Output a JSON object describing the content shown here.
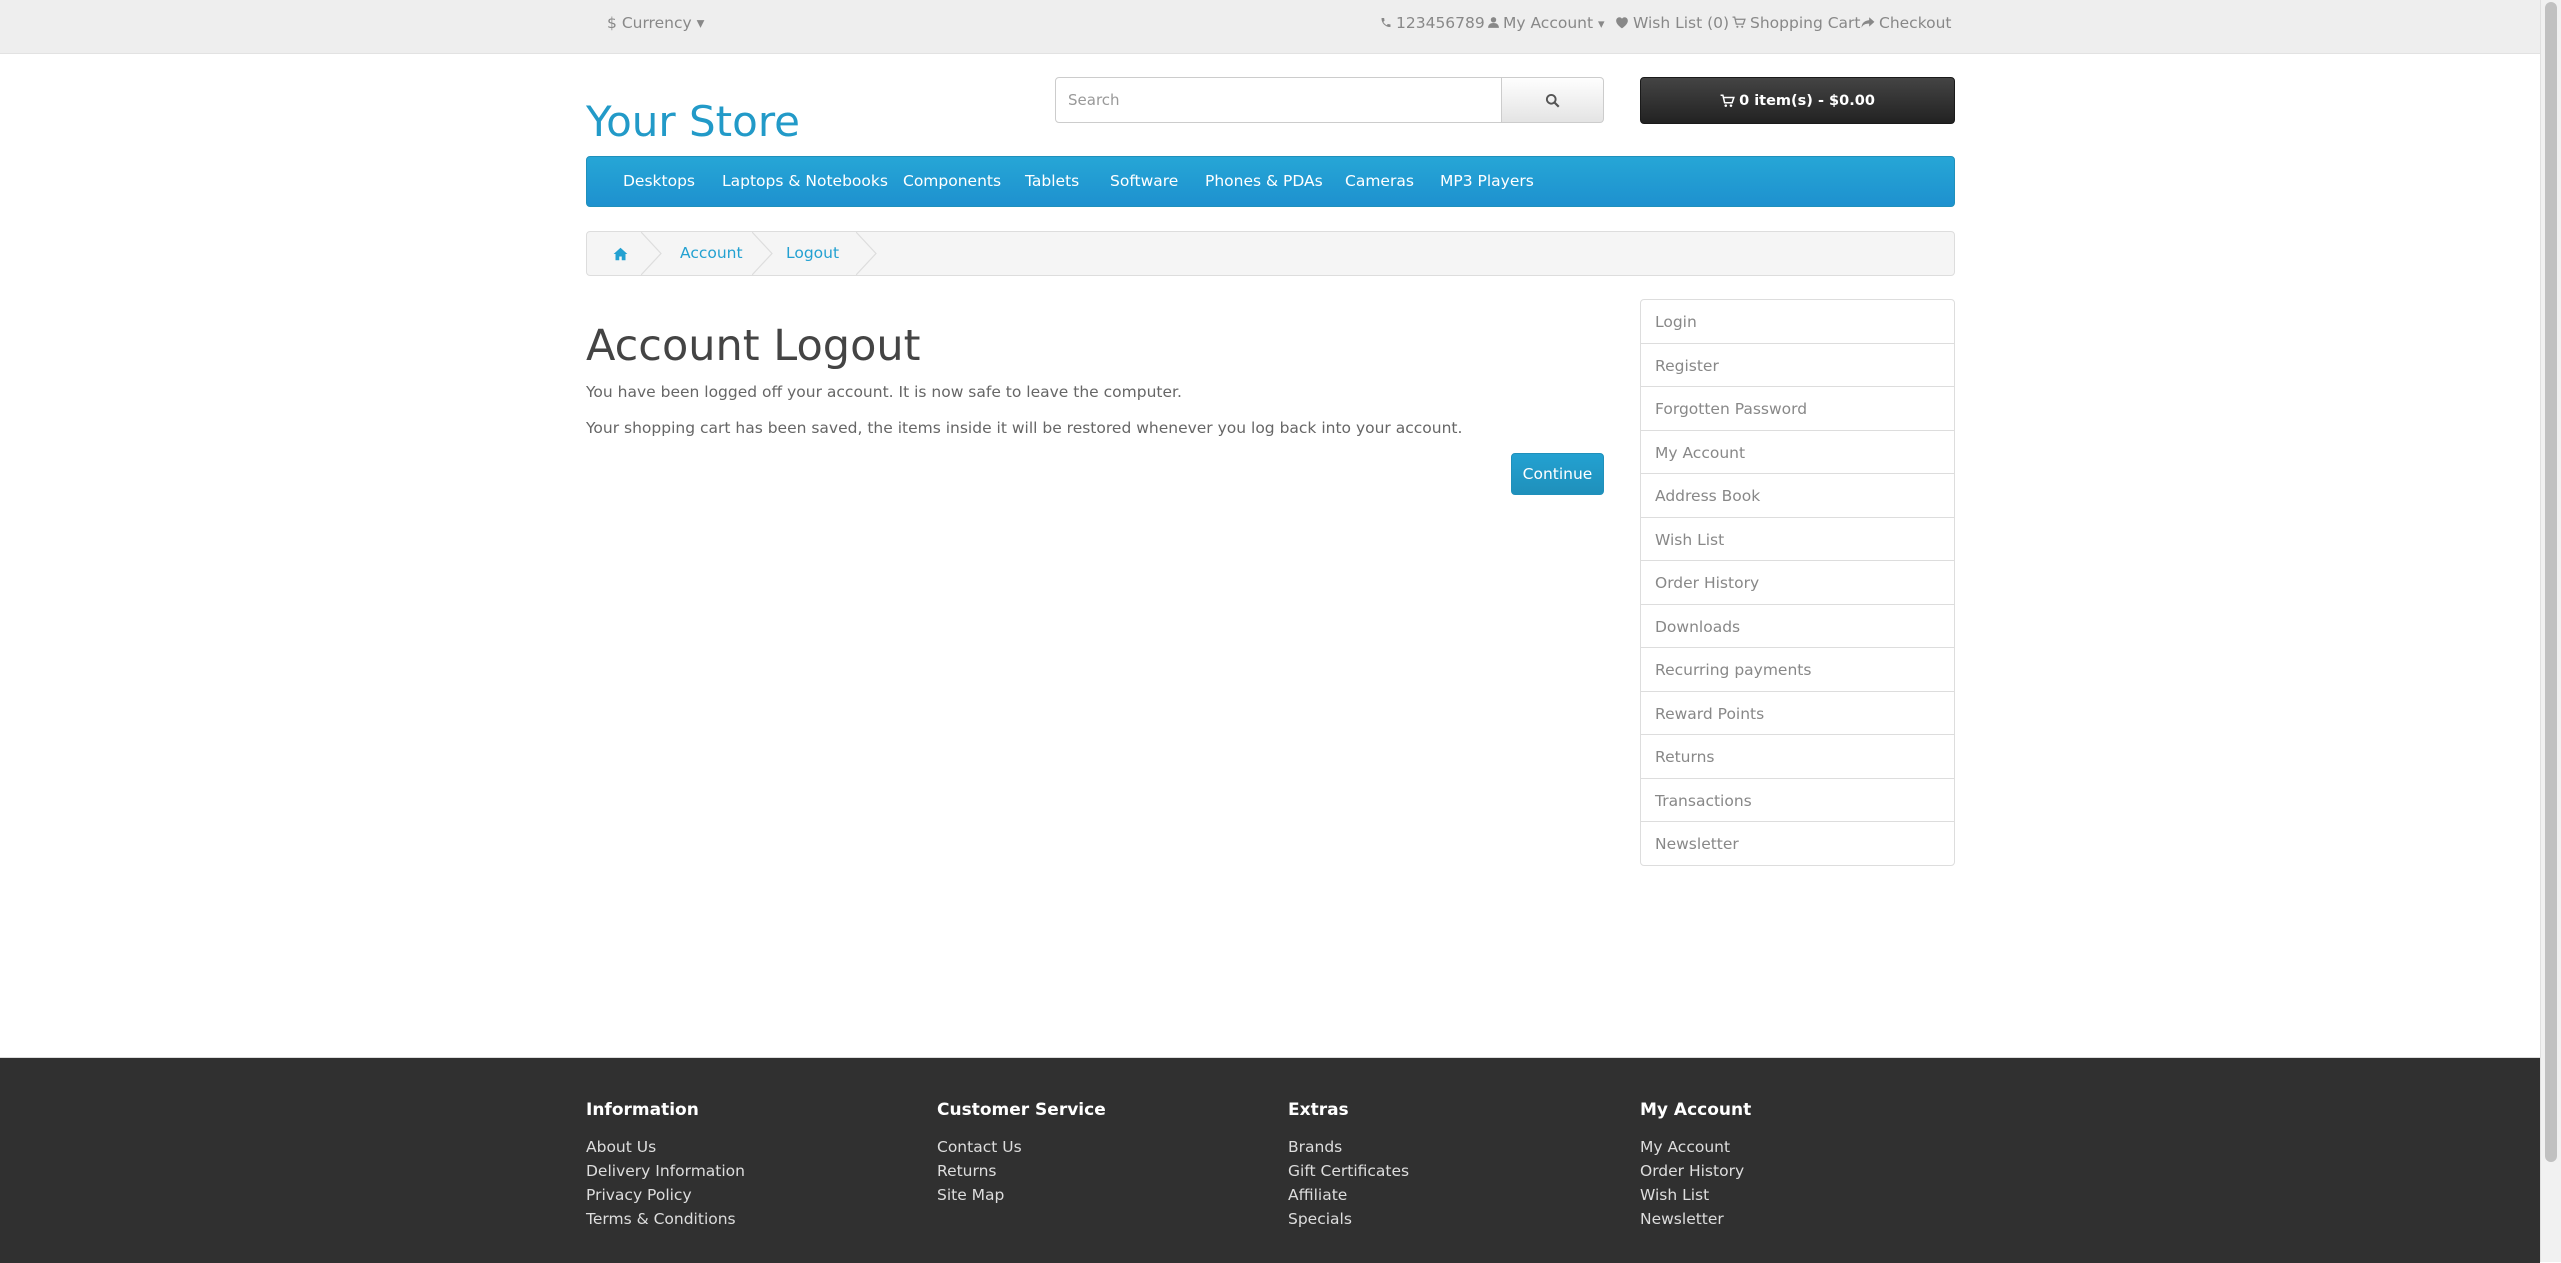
{
  "topbar": {
    "currency_label": "Currency",
    "currency_symbol": "$",
    "phone": "123456789",
    "my_account": "My Account",
    "wishlist": "Wish List (0)",
    "shopping_cart": "Shopping Cart",
    "checkout": "Checkout"
  },
  "header": {
    "logo": "Your Store",
    "search_placeholder": "Search",
    "cart": "0 item(s) - $0.00"
  },
  "menu": [
    "Desktops",
    "Laptops & Notebooks",
    "Components",
    "Tablets",
    "Software",
    "Phones & PDAs",
    "Cameras",
    "MP3 Players"
  ],
  "breadcrumb": [
    "Account",
    "Logout"
  ],
  "content": {
    "title": "Account Logout",
    "p1": "You have been logged off your account. It is now safe to leave the computer.",
    "p2": "Your shopping cart has been saved, the items inside it will be restored whenever you log back into your account.",
    "continue": "Continue"
  },
  "account_links": [
    "Login",
    "Register",
    "Forgotten Password",
    "My Account",
    "Address Book",
    "Wish List",
    "Order History",
    "Downloads",
    "Recurring payments",
    "Reward Points",
    "Returns",
    "Transactions",
    "Newsletter"
  ],
  "footer": {
    "information": {
      "heading": "Information",
      "links": [
        "About Us",
        "Delivery Information",
        "Privacy Policy",
        "Terms & Conditions"
      ]
    },
    "customer_service": {
      "heading": "Customer Service",
      "links": [
        "Contact Us",
        "Returns",
        "Site Map"
      ]
    },
    "extras": {
      "heading": "Extras",
      "links": [
        "Brands",
        "Gift Certificates",
        "Affiliate",
        "Specials"
      ]
    },
    "my_account": {
      "heading": "My Account",
      "links": [
        "My Account",
        "Order History",
        "Wish List",
        "Newsletter"
      ]
    }
  },
  "colors": {
    "accent": "#229ac8",
    "menu": "#229ac8",
    "footer_bg": "#303030"
  }
}
